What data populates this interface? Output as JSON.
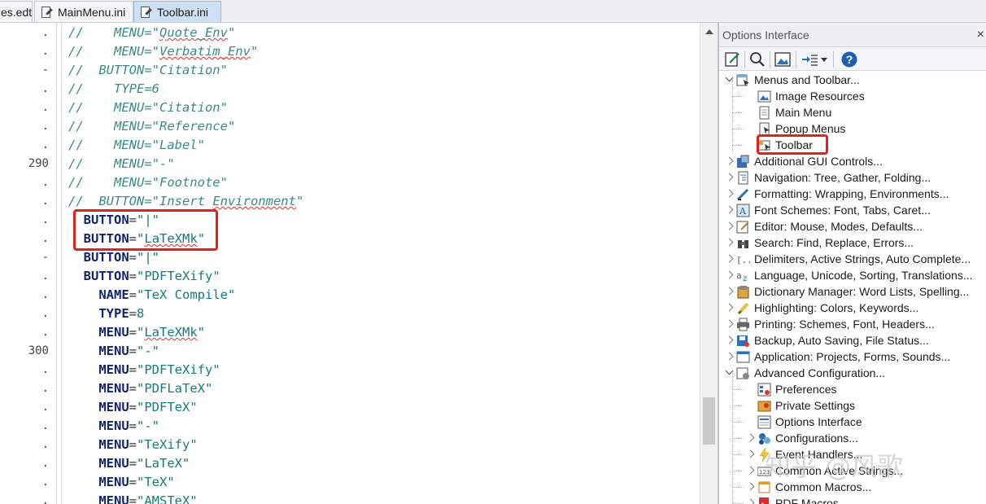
{
  "tabs": [
    {
      "label": "es.edt",
      "active": false
    },
    {
      "label": "MainMenu.ini",
      "active": false
    },
    {
      "label": "Toolbar.ini",
      "active": true
    }
  ],
  "gutter": [
    ".",
    ".",
    "-",
    ".",
    ".",
    ".",
    ".",
    "290",
    ".",
    ".",
    ".",
    ".",
    "-",
    ".",
    ".",
    ".",
    ".",
    "300",
    ".",
    ".",
    ".",
    ".",
    ".",
    ".",
    ".",
    "."
  ],
  "code_lines": [
    [
      {
        "t": "//    MENU=\"",
        "c": "cm"
      },
      {
        "t": "Quote_Env",
        "c": "cm squig"
      },
      {
        "t": "\"",
        "c": "cm"
      }
    ],
    [
      {
        "t": "//    MENU=\"",
        "c": "cm"
      },
      {
        "t": "Verbatim_Env",
        "c": "cm squig"
      },
      {
        "t": "\"",
        "c": "cm"
      }
    ],
    [
      {
        "t": "//  BUTTON=\"Citation\"",
        "c": "cm"
      }
    ],
    [
      {
        "t": "//    TYPE=6",
        "c": "cm"
      }
    ],
    [
      {
        "t": "//    MENU=\"Citation\"",
        "c": "cm"
      }
    ],
    [
      {
        "t": "//    MENU=\"Reference\"",
        "c": "cm"
      }
    ],
    [
      {
        "t": "//    MENU=\"Label\"",
        "c": "cm"
      }
    ],
    [
      {
        "t": "//    MENU=\"-\"",
        "c": "cm"
      }
    ],
    [
      {
        "t": "//    MENU=\"Footnote\"",
        "c": "cm"
      }
    ],
    [
      {
        "t": "//  BUTTON=\"Insert ",
        "c": "cm"
      },
      {
        "t": "Environment",
        "c": "cm squig"
      },
      {
        "t": "\"",
        "c": "cm"
      }
    ],
    [
      {
        "t": "  "
      },
      {
        "t": "BUTTON",
        "c": "kw"
      },
      {
        "t": "=",
        "c": "op"
      },
      {
        "t": "\"|\"",
        "c": "str"
      }
    ],
    [
      {
        "t": "  "
      },
      {
        "t": "BUTTON",
        "c": "kw"
      },
      {
        "t": "=",
        "c": "op"
      },
      {
        "t": "\"",
        "c": "str"
      },
      {
        "t": "LaTeXMk",
        "c": "str squig"
      },
      {
        "t": "\"",
        "c": "str"
      }
    ],
    [
      {
        "t": "  "
      },
      {
        "t": "BUTTON",
        "c": "kw"
      },
      {
        "t": "=",
        "c": "op"
      },
      {
        "t": "\"|\"",
        "c": "str"
      }
    ],
    [
      {
        "t": "  "
      },
      {
        "t": "BUTTON",
        "c": "kw"
      },
      {
        "t": "=",
        "c": "op"
      },
      {
        "t": "\"PDFTeXify\"",
        "c": "str"
      }
    ],
    [
      {
        "t": "    "
      },
      {
        "t": "NAME",
        "c": "kw"
      },
      {
        "t": "=",
        "c": "op"
      },
      {
        "t": "\"TeX Compile\"",
        "c": "str"
      }
    ],
    [
      {
        "t": "    "
      },
      {
        "t": "TYPE",
        "c": "kw"
      },
      {
        "t": "=",
        "c": "op"
      },
      {
        "t": "8",
        "c": "str"
      }
    ],
    [
      {
        "t": "    "
      },
      {
        "t": "MENU",
        "c": "kw"
      },
      {
        "t": "=",
        "c": "op"
      },
      {
        "t": "\"",
        "c": "str"
      },
      {
        "t": "LaTeXMk",
        "c": "str squig"
      },
      {
        "t": "\"",
        "c": "str"
      }
    ],
    [
      {
        "t": "    "
      },
      {
        "t": "MENU",
        "c": "kw"
      },
      {
        "t": "=",
        "c": "op"
      },
      {
        "t": "\"-\"",
        "c": "str"
      }
    ],
    [
      {
        "t": "    "
      },
      {
        "t": "MENU",
        "c": "kw"
      },
      {
        "t": "=",
        "c": "op"
      },
      {
        "t": "\"PDFTeXify\"",
        "c": "str"
      }
    ],
    [
      {
        "t": "    "
      },
      {
        "t": "MENU",
        "c": "kw"
      },
      {
        "t": "=",
        "c": "op"
      },
      {
        "t": "\"PDFLaTeX\"",
        "c": "str"
      }
    ],
    [
      {
        "t": "    "
      },
      {
        "t": "MENU",
        "c": "kw"
      },
      {
        "t": "=",
        "c": "op"
      },
      {
        "t": "\"PDFTeX\"",
        "c": "str"
      }
    ],
    [
      {
        "t": "    "
      },
      {
        "t": "MENU",
        "c": "kw"
      },
      {
        "t": "=",
        "c": "op"
      },
      {
        "t": "\"-\"",
        "c": "str"
      }
    ],
    [
      {
        "t": "    "
      },
      {
        "t": "MENU",
        "c": "kw"
      },
      {
        "t": "=",
        "c": "op"
      },
      {
        "t": "\"TeXify\"",
        "c": "str"
      }
    ],
    [
      {
        "t": "    "
      },
      {
        "t": "MENU",
        "c": "kw"
      },
      {
        "t": "=",
        "c": "op"
      },
      {
        "t": "\"LaTeX\"",
        "c": "str"
      }
    ],
    [
      {
        "t": "    "
      },
      {
        "t": "MENU",
        "c": "kw"
      },
      {
        "t": "=",
        "c": "op"
      },
      {
        "t": "\"TeX\"",
        "c": "str"
      }
    ],
    [
      {
        "t": "    "
      },
      {
        "t": "MENU",
        "c": "kw"
      },
      {
        "t": "=",
        "c": "op"
      },
      {
        "t": "\"AMSTeX\"",
        "c": "str"
      }
    ]
  ],
  "panel": {
    "title": "Options Interface",
    "close_glyph": "×"
  },
  "tree": [
    {
      "label": "Menus and Toolbar...",
      "level": 0,
      "expand": "down",
      "icon": "menus-toolbar-icon"
    },
    {
      "label": "Image Resources",
      "level": 1,
      "expand": "",
      "icon": "image-icon"
    },
    {
      "label": "Main Menu",
      "level": 1,
      "expand": "",
      "icon": "document-icon"
    },
    {
      "label": "Popup Menus",
      "level": 1,
      "expand": "",
      "icon": "popup-icon"
    },
    {
      "label": "Toolbar",
      "level": 1,
      "expand": "",
      "icon": "toolbar-icon",
      "highlight": true
    },
    {
      "label": "Additional GUI Controls...",
      "level": 0,
      "expand": "right",
      "icon": "gui-controls-icon"
    },
    {
      "label": "Navigation: Tree, Gather, Folding...",
      "level": 0,
      "expand": "right",
      "icon": "navigation-icon"
    },
    {
      "label": "Formatting: Wrapping, Environments...",
      "level": 0,
      "expand": "right",
      "icon": "formatting-icon"
    },
    {
      "label": "Font Schemes: Font, Tabs, Caret...",
      "level": 0,
      "expand": "right",
      "icon": "font-icon"
    },
    {
      "label": "Editor: Mouse, Modes, Defaults...",
      "level": 0,
      "expand": "right",
      "icon": "editor-icon"
    },
    {
      "label": "Search: Find, Replace, Errors...",
      "level": 0,
      "expand": "right",
      "icon": "binoculars-icon"
    },
    {
      "label": "Delimiters, Active Strings, Auto Complete...",
      "level": 0,
      "expand": "right",
      "icon": "delimiters-icon"
    },
    {
      "label": "Language, Unicode, Sorting, Translations...",
      "level": 0,
      "expand": "right",
      "icon": "language-icon"
    },
    {
      "label": "Dictionary Manager: Word Lists, Spelling...",
      "level": 0,
      "expand": "right",
      "icon": "dictionary-icon"
    },
    {
      "label": "Highlighting: Colors, Keywords...",
      "level": 0,
      "expand": "right",
      "icon": "highlighter-icon"
    },
    {
      "label": "Printing: Schemes, Font, Headers...",
      "level": 0,
      "expand": "right",
      "icon": "printer-icon"
    },
    {
      "label": "Backup, Auto Saving, File Status...",
      "level": 0,
      "expand": "right",
      "icon": "backup-icon"
    },
    {
      "label": "Application: Projects, Forms, Sounds...",
      "level": 0,
      "expand": "right",
      "icon": "application-icon"
    },
    {
      "label": "Advanced Configuration...",
      "level": 0,
      "expand": "down",
      "icon": "advanced-icon"
    },
    {
      "label": "Preferences",
      "level": 1,
      "expand": "",
      "icon": "preferences-icon"
    },
    {
      "label": "Private Settings",
      "level": 1,
      "expand": "",
      "icon": "private-settings-icon"
    },
    {
      "label": "Options Interface",
      "level": 1,
      "expand": "",
      "icon": "options-interface-icon"
    },
    {
      "label": "Configurations...",
      "level": 1,
      "expand": "right",
      "icon": "configurations-icon"
    },
    {
      "label": "Event Handlers...",
      "level": 1,
      "expand": "right",
      "icon": "lightning-icon"
    },
    {
      "label": "Common Active Strings...",
      "level": 1,
      "expand": "right",
      "icon": "numbers-icon"
    },
    {
      "label": "Common Macros...",
      "level": 1,
      "expand": "right",
      "icon": "macros-icon"
    },
    {
      "label": "PDF Macros...",
      "level": 1,
      "expand": "right",
      "icon": "pdf-icon"
    }
  ],
  "watermark": "知乎 @风歌",
  "colors": {
    "highlight_red": "#e0221c",
    "keyword": "#10246e",
    "string": "#177a7a",
    "comment": "#3a8a8a",
    "active_tab": "#cfe0f4"
  }
}
